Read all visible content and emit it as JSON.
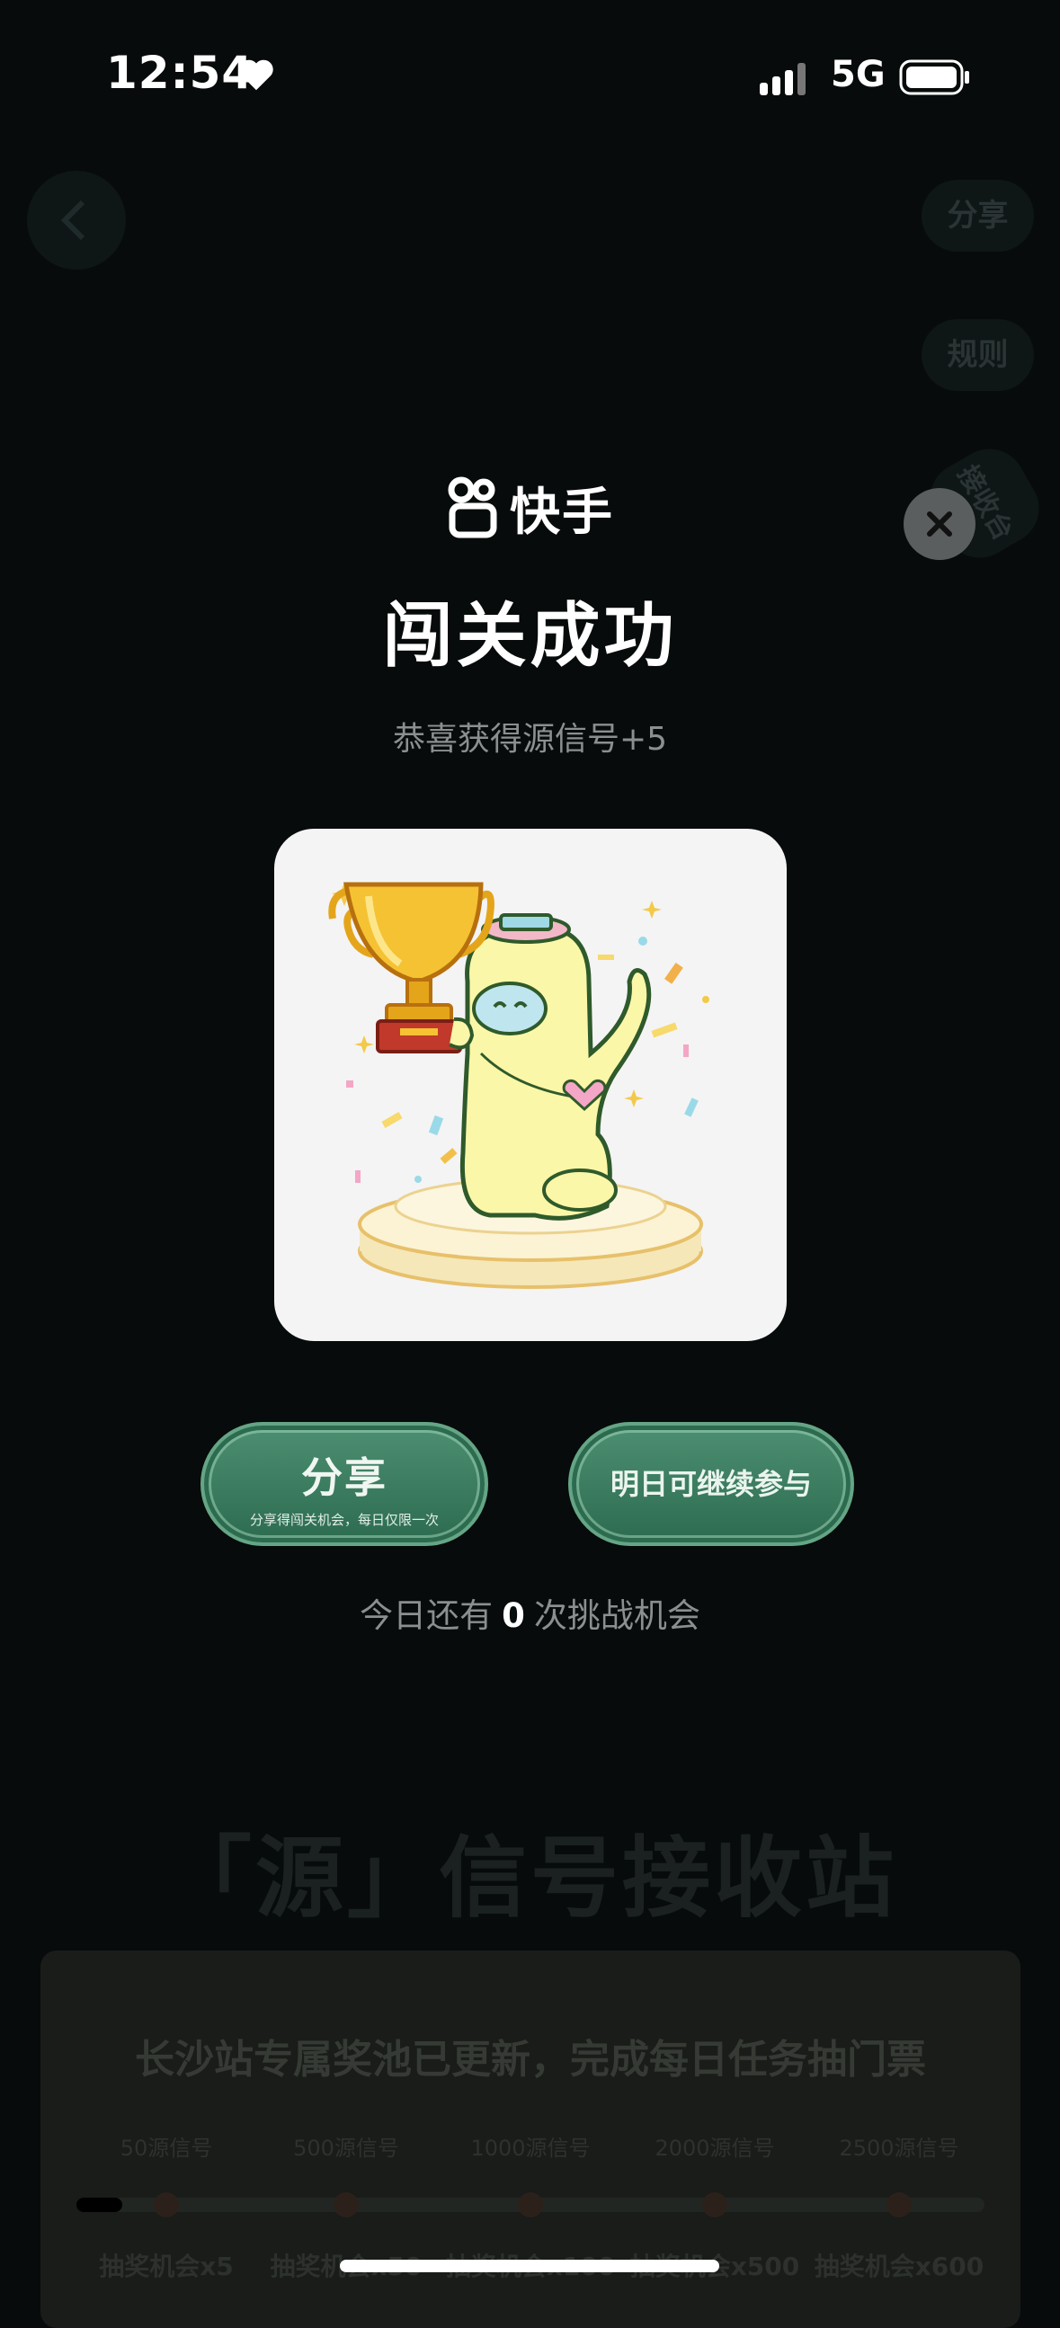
{
  "status_bar": {
    "time": "12:54",
    "network": "5G"
  },
  "background": {
    "share_label": "分享",
    "rules_label": "规则",
    "station_label": "接收台",
    "banner": "「源」信号接收站",
    "card_title": "长沙站专属奖池已更新，完成每日任务抽门票",
    "progress_fraction": 0.05,
    "tiers": [
      {
        "threshold": "50源信号",
        "prize": "抽奖机会x5"
      },
      {
        "threshold": "500源信号",
        "prize": "抽奖机会x50"
      },
      {
        "threshold": "1000源信号",
        "prize": "抽奖机会x100"
      },
      {
        "threshold": "2000源信号",
        "prize": "抽奖机会x500"
      },
      {
        "threshold": "2500源信号",
        "prize": "抽奖机会x600"
      }
    ]
  },
  "dialog": {
    "brand": "快手",
    "title": "闯关成功",
    "subtitle": "恭喜获得源信号+5",
    "share_button": {
      "label": "分享",
      "note": "分享得闯关机会，每日仅限一次"
    },
    "tomorrow_button": "明日可继续参与",
    "chances": {
      "prefix": "今日还有",
      "count": "0",
      "suffix": "次挑战机会"
    }
  },
  "colors": {
    "accent_green": "#3d7d60",
    "backdrop": "#070b0b"
  }
}
